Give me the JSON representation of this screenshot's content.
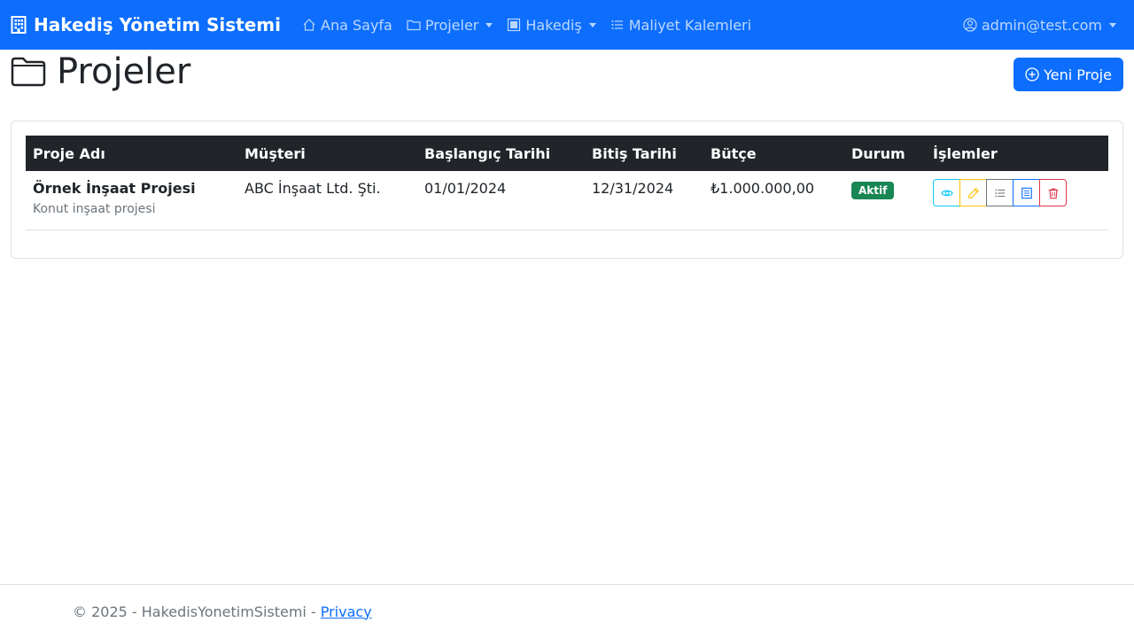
{
  "navbar": {
    "brand": "Hakediş Yönetim Sistemi",
    "items": [
      {
        "label": "Ana Sayfa",
        "icon": "house-icon",
        "dropdown": false
      },
      {
        "label": "Projeler",
        "icon": "folder-icon",
        "dropdown": true
      },
      {
        "label": "Hakediş",
        "icon": "receipt-icon",
        "dropdown": true
      },
      {
        "label": "Maliyet Kalemleri",
        "icon": "list-icon",
        "dropdown": false
      }
    ],
    "user": "admin@test.com"
  },
  "page": {
    "title": "Projeler",
    "new_button": "Yeni Proje"
  },
  "table": {
    "headers": [
      "Proje Adı",
      "Müşteri",
      "Başlangıç Tarihi",
      "Bitiş Tarihi",
      "Bütçe",
      "Durum",
      "İşlemler"
    ],
    "rows": [
      {
        "name": "Örnek İnşaat Projesi",
        "description": "Konut inşaat projesi",
        "customer": "ABC İnşaat Ltd. Şti.",
        "start_date": "01/01/2024",
        "end_date": "12/31/2024",
        "budget": "₺1.000.000,00",
        "status": "Aktif",
        "actions": [
          "eye-icon",
          "pencil-icon",
          "list-icon",
          "receipt-icon",
          "trash-icon"
        ]
      }
    ]
  },
  "footer": {
    "text": "© 2025 - HakedisYonetimSistemi -",
    "link": "Privacy"
  },
  "colors": {
    "primary": "#0d6efd",
    "dark": "#212529",
    "success": "#198754",
    "info": "#0dcaf0",
    "warning": "#ffc107",
    "secondary": "#6c757d",
    "danger": "#dc3545"
  }
}
